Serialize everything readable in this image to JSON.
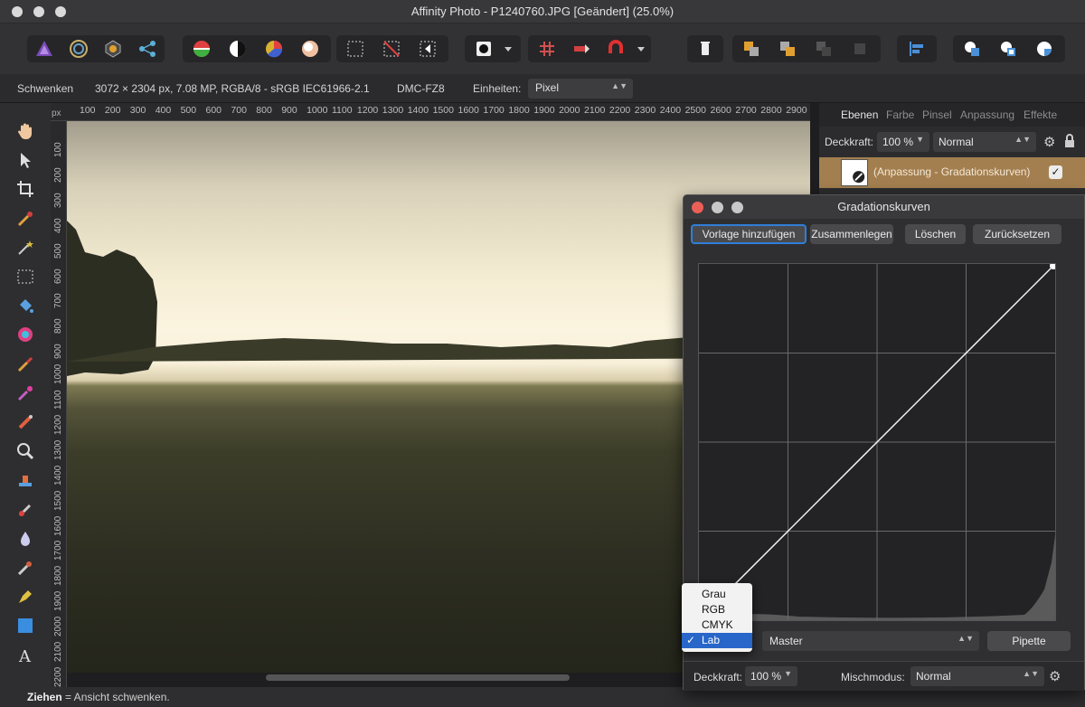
{
  "window": {
    "title": "Affinity Photo - P1240760.JPG [Geändert] (25.0%)"
  },
  "toolbar": {
    "personas": [
      "photo-persona-icon",
      "liquify-persona-icon",
      "develop-persona-icon",
      "export-persona-icon"
    ],
    "adjust_icons": [
      "auto-levels-icon",
      "auto-contrast-icon",
      "auto-colors-icon",
      "auto-white-balance-icon"
    ],
    "select_icons": [
      "select-all-icon",
      "deselect-icon",
      "invert-selection-icon"
    ],
    "mode": "quick-mask-icon",
    "snap_icons": [
      "grid-icon",
      "assistant-icon",
      "snapping-icon"
    ],
    "arrange_icons": [
      "trash-icon",
      "move-back-icon",
      "move-forward-icon",
      "move-front-icon",
      "move-back-one-icon"
    ],
    "align_icon": "align-left-icon",
    "boolean_icons": [
      "add-icon",
      "subtract-icon",
      "intersect-icon"
    ]
  },
  "contextbar": {
    "tool": "Schwenken",
    "doc_info": "3072 × 2304 px, 7.08 MP, RGBA/8 - sRGB IEC61966-2.1",
    "camera": "DMC-FZ8",
    "units_label": "Einheiten:",
    "units_value": "Pixel"
  },
  "ruler": {
    "unit": "px",
    "top": [
      "100",
      "200",
      "300",
      "400",
      "500",
      "600",
      "700",
      "800",
      "900",
      "1000",
      "1100",
      "1200",
      "1300",
      "1400",
      "1500",
      "1600",
      "1700",
      "1800",
      "1900",
      "2000",
      "2100",
      "2200",
      "2300",
      "2400",
      "2500",
      "2600",
      "2700",
      "2800",
      "2900"
    ],
    "left": [
      "100",
      "200",
      "300",
      "400",
      "500",
      "600",
      "700",
      "800",
      "900",
      "1000",
      "1100",
      "1200",
      "1300",
      "1400",
      "1500",
      "1600",
      "1700",
      "1800",
      "1900",
      "2000",
      "2100",
      "2200"
    ]
  },
  "tools": [
    "hand-icon",
    "move-icon",
    "crop-icon",
    "brush-selection-icon",
    "magic-wand-icon",
    "marquee-icon",
    "flood-fill-icon",
    "color-picker-icon",
    "paint-brush-icon",
    "dodge-burn-icon",
    "clone-icon",
    "zoom-icon",
    "stamp-icon",
    "healing-icon",
    "blur-icon",
    "smudge-icon",
    "pen-icon",
    "shape-icon",
    "text-icon"
  ],
  "status": {
    "key": "Ziehen",
    "text": " = Ansicht schwenken."
  },
  "panel": {
    "tabs": [
      "Ebenen",
      "Farbe",
      "Pinsel",
      "Anpassung",
      "Effekte"
    ],
    "opacity_label": "Deckkraft:",
    "opacity_value": "100 %",
    "blend_value": "Normal",
    "layer_name": "(Anpassung - Gradationskurven)"
  },
  "curves": {
    "title": "Gradationskurven",
    "buttons": {
      "preset": "Vorlage hinzufügen",
      "merge": "Zusammenlegen",
      "delete": "Löschen",
      "reset": "Zurücksetzen"
    },
    "channel_menu": [
      "Grau",
      "RGB",
      "CMYK",
      "Lab"
    ],
    "selected_channel": "Lab",
    "check": "✓",
    "master": "Master",
    "pipette": "Pipette",
    "opacity_label": "Deckkraft:",
    "opacity_value": "100 %",
    "blend_label": "Mischmodus:",
    "blend_value": "Normal"
  },
  "colors": {
    "accent": "#2f7ed8",
    "layer_row": "#a37f50"
  }
}
